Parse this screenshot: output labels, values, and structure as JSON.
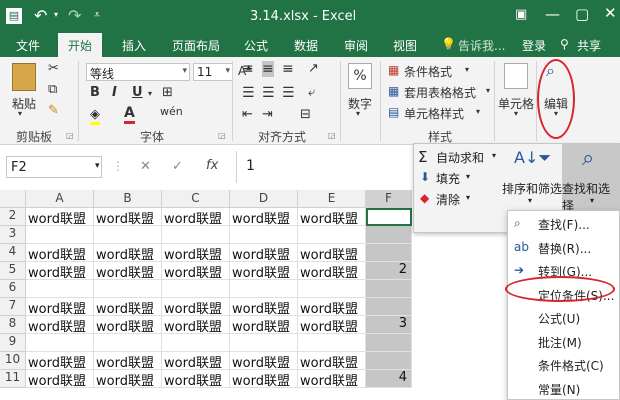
{
  "window": {
    "title": "3.14.xlsx - Excel"
  },
  "tabs": [
    "文件",
    "开始",
    "插入",
    "页面布局",
    "公式",
    "数据",
    "审阅",
    "视图"
  ],
  "tell_me": "告诉我...",
  "login": "登录",
  "share": "共享",
  "ribbon": {
    "paste": "粘贴",
    "clipboard_label": "剪贴板",
    "font_name": "等线",
    "font_size": "11",
    "font_label": "字体",
    "align_label": "对齐方式",
    "number_label": "数字",
    "conditional_format": "条件格式",
    "table_format": "套用表格格式",
    "cell_style": "单元格样式",
    "styles_label": "样式",
    "cells_label": "单元格",
    "edit_label": "编辑"
  },
  "formula_bar": {
    "name_box": "F2",
    "fx": "fx",
    "value": "1"
  },
  "edit_panel": {
    "autosum": "自动求和",
    "fill": "填充",
    "clear": "清除",
    "sort_filter": "排序和筛选",
    "find_select": "查找和选择"
  },
  "menu": [
    {
      "label": "查找(F)...",
      "icon": "magnifier-icon"
    },
    {
      "label": "替换(R)...",
      "icon": "replace-icon"
    },
    {
      "label": "转到(G)...",
      "icon": "arrow-right-icon"
    },
    {
      "label": "定位条件(S)...",
      "icon": ""
    },
    {
      "label": "公式(U)",
      "icon": ""
    },
    {
      "label": "批注(M)",
      "icon": ""
    },
    {
      "label": "条件格式(C)",
      "icon": ""
    },
    {
      "label": "常量(N)",
      "icon": ""
    }
  ],
  "sheet": {
    "columns": [
      "A",
      "B",
      "C",
      "D",
      "E",
      "F"
    ],
    "rows": [
      {
        "num": "2",
        "cells": [
          "word联盟",
          "word联盟",
          "word联盟",
          "word联盟",
          "word联盟",
          ""
        ]
      },
      {
        "num": "3",
        "cells": [
          "",
          "",
          "",
          "",
          "",
          ""
        ]
      },
      {
        "num": "4",
        "cells": [
          "word联盟",
          "word联盟",
          "word联盟",
          "word联盟",
          "word联盟",
          ""
        ]
      },
      {
        "num": "5",
        "cells": [
          "word联盟",
          "word联盟",
          "word联盟",
          "word联盟",
          "word联盟",
          "2"
        ]
      },
      {
        "num": "6",
        "cells": [
          "",
          "",
          "",
          "",
          "",
          ""
        ]
      },
      {
        "num": "7",
        "cells": [
          "word联盟",
          "word联盟",
          "word联盟",
          "word联盟",
          "word联盟",
          ""
        ]
      },
      {
        "num": "8",
        "cells": [
          "word联盟",
          "word联盟",
          "word联盟",
          "word联盟",
          "word联盟",
          "3"
        ]
      },
      {
        "num": "9",
        "cells": [
          "",
          "",
          "",
          "",
          "",
          ""
        ]
      },
      {
        "num": "10",
        "cells": [
          "word联盟",
          "word联盟",
          "word联盟",
          "word联盟",
          "word联盟",
          ""
        ]
      },
      {
        "num": "11",
        "cells": [
          "word联盟",
          "word联盟",
          "word联盟",
          "word联盟",
          "word联盟",
          "4"
        ]
      }
    ]
  },
  "colors": {
    "accent": "#217346",
    "highlight": "#d9232f",
    "selected_col": "#c6c6c6"
  }
}
